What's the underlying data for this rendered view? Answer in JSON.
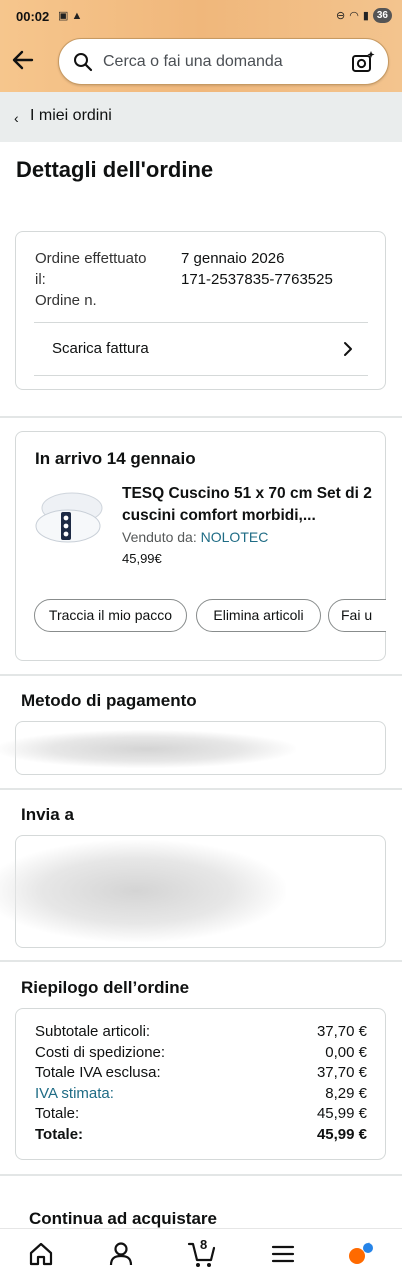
{
  "status": {
    "time": "00:02",
    "battery": "36"
  },
  "search": {
    "placeholder": "Cerca o fai una domanda"
  },
  "breadcrumb": {
    "label": "I miei ordini"
  },
  "page_title": "Dettagli dell'ordine",
  "order_info": {
    "placed_label": "Ordine effettuato il:",
    "placed_value": "7 gennaio 2026",
    "number_label": "Ordine n.",
    "number_value": "171-2537835-7763525",
    "invoice_label": "Scarica fattura"
  },
  "shipment": {
    "title": "In arrivo 14 gennaio",
    "product_name": "TESQ Cuscino 51 x 70 cm Set di 2 cuscini comfort morbidi,...",
    "sold_by_label": "Venduto da:",
    "seller": "NOLOTEC",
    "price": "45,99€",
    "actions": [
      "Traccia il mio pacco",
      "Elimina articoli",
      "Fai u"
    ]
  },
  "payment": {
    "title": "Metodo di pagamento"
  },
  "ship_to": {
    "title": "Invia a"
  },
  "summary": {
    "title": "Riepilogo dell’ordine",
    "rows": [
      {
        "label": "Subtotale articoli:",
        "value": "37,70 €"
      },
      {
        "label": "Costi di spedizione:",
        "value": "0,00 €"
      },
      {
        "label": "Totale IVA esclusa:",
        "value": "37,70 €"
      },
      {
        "label": "IVA stimata:",
        "value": "8,29 €"
      },
      {
        "label": "Totale:",
        "value": "45,99 €"
      },
      {
        "label": "Totale:",
        "value": "45,99 €"
      }
    ]
  },
  "continue": {
    "title": "Continua ad acquistare"
  },
  "nav": {
    "cart_count": "8"
  },
  "colors": {
    "header": "#f0b77b",
    "link": "#1f6c85",
    "alexa": "#ff6a00"
  }
}
